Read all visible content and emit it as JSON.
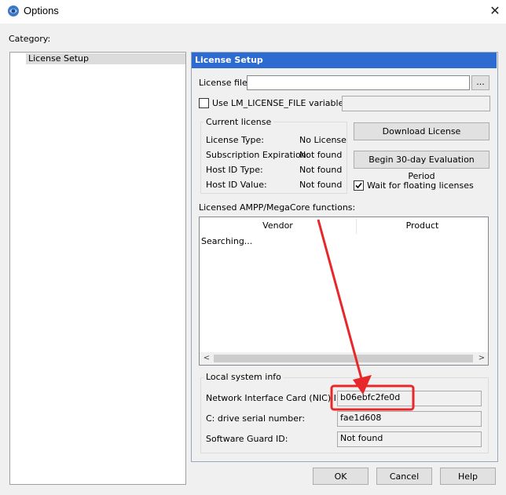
{
  "window": {
    "title": "Options",
    "close_glyph": "✕"
  },
  "category": {
    "label": "Category:",
    "items": [
      {
        "label": "License Setup"
      }
    ]
  },
  "license_setup": {
    "header": "License Setup",
    "license_file_label": "License file:",
    "license_file_value": "",
    "browse_label": "...",
    "use_lm_checkbox_label": "Use LM_LICENSE_FILE variable:",
    "use_lm_checked": false,
    "lm_value": "",
    "current_license": {
      "title": "Current license",
      "rows": [
        {
          "label": "License Type:",
          "value": "No License"
        },
        {
          "label": "Subscription Expiration:",
          "value": "Not found"
        },
        {
          "label": "Host ID Type:",
          "value": "Not found"
        },
        {
          "label": "Host ID Value:",
          "value": "Not found"
        }
      ]
    },
    "download_button": "Download License",
    "eval_button": "Begin 30-day Evaluation Period",
    "wait_floating_label": "Wait for floating licenses",
    "wait_floating_checked": true,
    "ampp": {
      "title": "Licensed AMPP/MegaCore functions:",
      "columns": [
        "Vendor",
        "Product"
      ],
      "status": "Searching..."
    },
    "local_system": {
      "title": "Local system info",
      "rows": [
        {
          "label": "Network Interface Card (NIC) ID:",
          "value": "b06ebfc2fe0d"
        },
        {
          "label": "C: drive serial number:",
          "value": "fae1d608"
        },
        {
          "label": "Software Guard ID:",
          "value": "Not found"
        }
      ]
    }
  },
  "buttons": {
    "ok": "OK",
    "cancel": "Cancel",
    "help": "Help"
  },
  "annotation": {
    "color": "#e8272a"
  }
}
